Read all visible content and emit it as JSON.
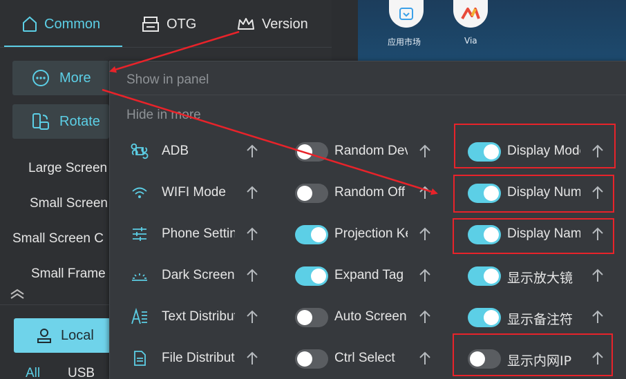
{
  "tabs": [
    {
      "label": "Common",
      "icon": "home-icon",
      "active": true
    },
    {
      "label": "OTG",
      "icon": "printer-icon",
      "active": false
    },
    {
      "label": "Version",
      "icon": "crown-icon",
      "active": false
    }
  ],
  "sidebar": {
    "more_label": "More",
    "rotate_label": "Rotate",
    "items": [
      "Large Screen",
      "Small Screen",
      "Small Screen C",
      "Small Frame"
    ],
    "local_label": "Local",
    "filters": [
      "All",
      "USB"
    ]
  },
  "desktop": {
    "apps": [
      {
        "label": "应用市场",
        "icon": "app-market-icon"
      },
      {
        "label": "Via",
        "icon": "via-browser-icon"
      }
    ]
  },
  "panel": {
    "show_title": "Show in panel",
    "hide_title": "Hide in more",
    "column1": [
      {
        "label": "ADB",
        "icon": "command-icon"
      },
      {
        "label": "WIFI Mode",
        "icon": "wifi-icon"
      },
      {
        "label": "Phone Settings",
        "icon": "sliders-icon"
      },
      {
        "label": "Dark Screen",
        "icon": "sunrise-icon"
      },
      {
        "label": "Text Distribution",
        "icon": "text-icon"
      },
      {
        "label": "File Distribution",
        "icon": "file-icon"
      }
    ],
    "column2": [
      {
        "label": "Random Device",
        "on": false
      },
      {
        "label": "Random Off",
        "on": false
      },
      {
        "label": "Projection Key",
        "on": true
      },
      {
        "label": "Expand Tag",
        "on": true
      },
      {
        "label": "Auto Screen",
        "on": false
      },
      {
        "label": "Ctrl Select",
        "on": false
      }
    ],
    "column3": [
      {
        "label": "Display Model",
        "on": true
      },
      {
        "label": "Display Number",
        "on": true
      },
      {
        "label": "Display Name",
        "on": true
      },
      {
        "label": "显示放大镜",
        "on": true
      },
      {
        "label": "显示备注符",
        "on": true
      },
      {
        "label": "显示内网IP",
        "on": false
      }
    ]
  },
  "colors": {
    "accent": "#5ccfe6",
    "annotation": "#e8232a"
  }
}
